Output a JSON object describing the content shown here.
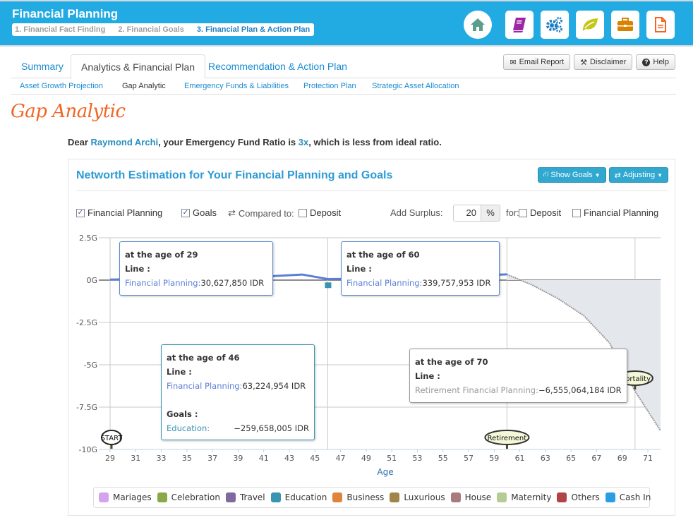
{
  "app": {
    "title": "Financial Planning",
    "steps": [
      {
        "label": "1. Financial Fact Finding",
        "active": false
      },
      {
        "label": "2. Financial Goals",
        "active": false
      },
      {
        "label": "3. Financial Plan & Action Plan",
        "active": true
      }
    ],
    "nav_icons": [
      {
        "name": "home-icon",
        "color": "#5c9e8c"
      },
      {
        "name": "book-icon",
        "color": "#9b27a5"
      },
      {
        "name": "gears-icon",
        "color": "#1f7fc2"
      },
      {
        "name": "leaf-icon",
        "color": "#c6c619"
      },
      {
        "name": "briefcase-icon",
        "color": "#d98200"
      },
      {
        "name": "document-icon",
        "color": "#f26522"
      }
    ]
  },
  "tabs": [
    {
      "label": "Summary",
      "active": false
    },
    {
      "label": "Analytics & Financial Plan",
      "active": true
    },
    {
      "label": "Recommendation & Action Plan",
      "active": false
    }
  ],
  "toolbar": {
    "email_label": "Email Report",
    "disclaimer_label": "Disclaimer",
    "help_label": "Help"
  },
  "subtabs": [
    {
      "label": "Asset Growth Projection",
      "active": false
    },
    {
      "label": "Gap Analytic",
      "active": true
    },
    {
      "label": "Emergency Funds & Liabilities",
      "active": false
    },
    {
      "label": "Protection Plan",
      "active": false
    },
    {
      "label": "Strategic Asset Allocation",
      "active": false
    }
  ],
  "page": {
    "title": "Gap Analytic",
    "greeting": {
      "prefix": "Dear ",
      "name": "Raymond Archi",
      "middle": ", your Emergency Fund Ratio is ",
      "ratio": "3x",
      "suffix": ", which is less from ideal ratio."
    }
  },
  "panel": {
    "title": "Networth Estimation for Your Financial Planning and Goals",
    "show_goals_label": "Show Goals",
    "adjusting_label": "Adjusting",
    "options": {
      "financial_planning": {
        "label": "Financial Planning",
        "checked": true
      },
      "goals": {
        "label": "Goals",
        "checked": true
      },
      "compared_to_label": "Compared to:",
      "deposit": {
        "label": "Deposit",
        "checked": false
      },
      "add_surplus_label": "Add Surplus:",
      "surplus_value": "20",
      "surplus_unit": "%",
      "for_label": "for:",
      "for_deposit": {
        "label": "Deposit",
        "checked": false
      },
      "for_financial_planning": {
        "label": "Financial Planning",
        "checked": false
      }
    }
  },
  "chart_data": {
    "type": "line",
    "title": "Networth Estimation for Your Financial Planning and Goals",
    "xlabel": "Age",
    "ylabel": "",
    "xlim": [
      29,
      72
    ],
    "ylim": [
      -10,
      2.5
    ],
    "y_unit": "G (billion IDR)",
    "x_ticks": [
      29,
      31,
      33,
      35,
      37,
      39,
      41,
      43,
      45,
      47,
      49,
      51,
      53,
      55,
      57,
      59,
      61,
      63,
      65,
      67,
      69,
      71
    ],
    "y_ticks": [
      {
        "value": 2.5,
        "label": "2.5G"
      },
      {
        "value": 0,
        "label": "0G"
      },
      {
        "value": -2.5,
        "label": "-2.5G"
      },
      {
        "value": -5,
        "label": "-5G"
      },
      {
        "value": -7.5,
        "label": "-7.5G"
      },
      {
        "value": -10,
        "label": "-10G"
      }
    ],
    "grid": true,
    "vertical_markers": [
      29,
      46,
      60,
      70
    ],
    "series": [
      {
        "name": "Financial Planning",
        "color": "#5b7fd6",
        "points": [
          [
            29,
            0.031
          ],
          [
            35,
            0.1
          ],
          [
            40,
            0.17
          ],
          [
            44,
            0.33
          ],
          [
            46,
            0.063
          ],
          [
            48,
            0.08
          ],
          [
            55,
            0.2
          ],
          [
            60,
            0.34
          ]
        ]
      },
      {
        "name": "Retirement Financial Planning",
        "color": "#999999",
        "style": "dotted",
        "area": true,
        "points": [
          [
            60,
            0.34
          ],
          [
            62,
            -0.3
          ],
          [
            64,
            -1.1
          ],
          [
            66,
            -2.1
          ],
          [
            68,
            -3.7
          ],
          [
            70,
            -6.555
          ],
          [
            72,
            -8.9
          ]
        ]
      }
    ],
    "goal_markers": [
      {
        "age": 46,
        "category": "Education",
        "value": -0.2597
      }
    ],
    "milestones": [
      {
        "label": "START",
        "age": 29
      },
      {
        "label": "Retirement",
        "age": 60
      },
      {
        "label": "Mortality",
        "age": 70
      }
    ],
    "tooltips": [
      {
        "title": "at the age of 29",
        "line_label": "Line :",
        "rows": [
          {
            "name": "Financial Planning:",
            "value": "30,627,850 IDR"
          }
        ]
      },
      {
        "title": "at the age of 60",
        "line_label": "Line :",
        "rows": [
          {
            "name": "Financial Planning:",
            "value": "339,757,953 IDR"
          }
        ]
      },
      {
        "title": "at the age of 46",
        "line_label": "Line :",
        "rows": [
          {
            "name": "Financial Planning:",
            "value": "63,224,954 IDR"
          }
        ],
        "goals_label": "Goals :",
        "goals": [
          {
            "name": "Education:",
            "value": "−259,658,005 IDR"
          }
        ]
      },
      {
        "title": "at the age of 70",
        "line_label": "Line :",
        "rows": [
          {
            "name": "Retirement Financial Planning:",
            "value": "−6,555,064,184 IDR"
          }
        ]
      }
    ],
    "legend": [
      {
        "label": "Mariages",
        "color": "#d4a3f0"
      },
      {
        "label": "Celebration",
        "color": "#8aa84a"
      },
      {
        "label": "Travel",
        "color": "#7e6a9e"
      },
      {
        "label": "Education",
        "color": "#3a93b0"
      },
      {
        "label": "Business",
        "color": "#e0843c"
      },
      {
        "label": "Luxurious",
        "color": "#a08448"
      },
      {
        "label": "House",
        "color": "#a87c7c"
      },
      {
        "label": "Maternity",
        "color": "#b5cc94"
      },
      {
        "label": "Others",
        "color": "#b04444"
      },
      {
        "label": "Cash In",
        "color": "#2a9ee0"
      }
    ]
  }
}
